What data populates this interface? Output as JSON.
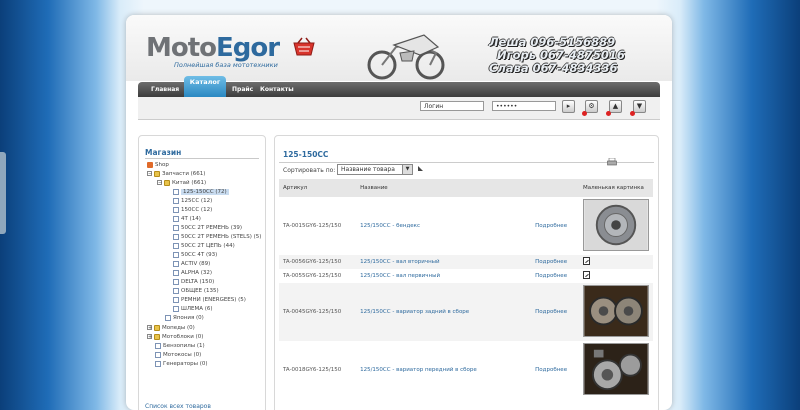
{
  "header": {
    "logo_part1": "Moto",
    "logo_part2": "Egor",
    "tagline": "Полнейшая база мототехники",
    "phones": [
      "Леша 096-5156889",
      "Игорь 067-4875016",
      "Слава 067-4834336"
    ]
  },
  "nav": {
    "items": [
      {
        "label": "Главная"
      },
      {
        "label": "Каталог",
        "active": true
      },
      {
        "label": "Прайс"
      },
      {
        "label": "Контакты"
      }
    ]
  },
  "login": {
    "login_value": "Логин",
    "password_value": "••••••"
  },
  "sidebar": {
    "title": "Магазин",
    "tree": [
      {
        "label": "Shop",
        "icon": "shop-icon"
      },
      {
        "label": "Запчасти (661)",
        "icon": "folder-icon",
        "expand": "−"
      },
      {
        "label": "Китай (661)",
        "icon": "folder-icon",
        "expand": "−"
      },
      {
        "label": "125-150CC (72)",
        "icon": "doc-icon",
        "selected": true
      },
      {
        "label": "125CC (12)",
        "icon": "doc-icon"
      },
      {
        "label": "150CC (12)",
        "icon": "doc-icon"
      },
      {
        "label": "4T (14)",
        "icon": "doc-icon"
      },
      {
        "label": "50CC 2T РЕМЕНЬ (39)",
        "icon": "doc-icon"
      },
      {
        "label": "50CC 2T РЕМЕНЬ (STELS) (5)",
        "icon": "doc-icon"
      },
      {
        "label": "50CC 2T ЦЕПЬ (44)",
        "icon": "doc-icon"
      },
      {
        "label": "50CC 4T (93)",
        "icon": "doc-icon"
      },
      {
        "label": "ACTIV (89)",
        "icon": "doc-icon"
      },
      {
        "label": "ALPHA (32)",
        "icon": "doc-icon"
      },
      {
        "label": "DELTA (150)",
        "icon": "doc-icon"
      },
      {
        "label": "ОБЩЕЕ (135)",
        "icon": "doc-icon"
      },
      {
        "label": "РЕМНИ (ENERGEES) (5)",
        "icon": "doc-icon"
      },
      {
        "label": "ШЛЕМА (6)",
        "icon": "doc-icon"
      },
      {
        "label": "Япония (0)",
        "icon": "doc-icon"
      },
      {
        "label": "Мопеды (0)",
        "icon": "folder-icon",
        "expand": "+"
      },
      {
        "label": "Мотоблоки (0)",
        "icon": "folder-icon",
        "expand": "+"
      },
      {
        "label": "Бензопилы (1)",
        "icon": "doc-icon"
      },
      {
        "label": "Мотокосы (0)",
        "icon": "doc-icon"
      },
      {
        "label": "Генераторы (0)",
        "icon": "doc-icon"
      }
    ],
    "all_products": "Список всех товаров"
  },
  "main": {
    "title": "125-150CC",
    "sort_label": "Сортировать по:",
    "sort_value": "Название товара",
    "columns": [
      "Артикул",
      "Название",
      "",
      "Маленькая картинка"
    ],
    "rows": [
      {
        "sku": "TA-0015GY6-125/150",
        "name": "125/150CC - бендекс",
        "more": "Подробнее",
        "image": "gear-photo"
      },
      {
        "sku": "TA-0056GY6-125/150",
        "name": "125/150CC - вал вторичный",
        "more": "Подробнее",
        "image": "none"
      },
      {
        "sku": "TA-0055GY6-125/150",
        "name": "125/150CC - вал первичный",
        "more": "Подробнее",
        "image": "none"
      },
      {
        "sku": "TA-0045GY6-125/150",
        "name": "125/150CC - вариатор задний в сборе",
        "more": "Подробнее",
        "image": "clutch-photo"
      },
      {
        "sku": "TA-0018GY6-125/150",
        "name": "125/150CC - вариатор передний в сборе",
        "more": "Подробнее",
        "image": "variator-photo"
      }
    ]
  },
  "colors": {
    "accent": "#2e6a9e",
    "nav": "#4a4a4a",
    "active_tab": "#3a9bd5"
  }
}
